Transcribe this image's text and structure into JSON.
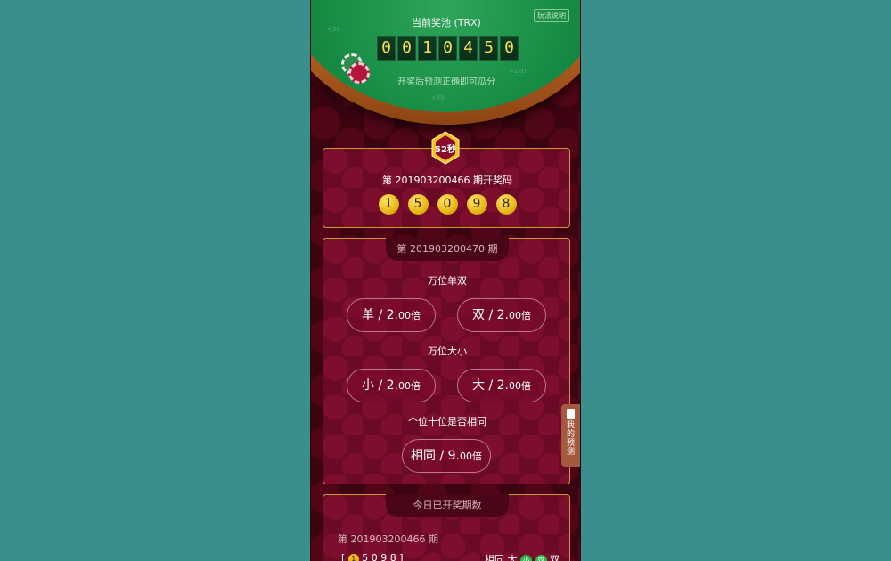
{
  "jackpot": {
    "title": "当前奖池 (TRX)",
    "rules_label": "玩法说明",
    "digits": [
      "0",
      "0",
      "1",
      "0",
      "4",
      "5",
      "0"
    ],
    "note": "开奖后预测正确即可瓜分",
    "faint_values": [
      "+50",
      "+220",
      "+50"
    ]
  },
  "timer": {
    "label": "52秒"
  },
  "last_result": {
    "title": "第 201903200466 期开奖码",
    "numbers": [
      "1",
      "5",
      "0",
      "9",
      "8"
    ]
  },
  "current_round": {
    "tab": "第 201903200470 期",
    "sections": [
      {
        "label": "万位单双",
        "options": [
          {
            "name": "单 / 2.",
            "odds": "00倍"
          },
          {
            "name": "双 / 2.",
            "odds": "00倍"
          }
        ]
      },
      {
        "label": "万位大小",
        "options": [
          {
            "name": "小 / 2.",
            "odds": "00倍"
          },
          {
            "name": "大 / 2.",
            "odds": "00倍"
          }
        ]
      },
      {
        "label": "个位十位是否相同",
        "options": [
          {
            "name": "相同 / 9.",
            "odds": "00倍"
          }
        ]
      }
    ]
  },
  "history": {
    "tab": "今日已开奖期数",
    "item": "第 201903200466 期",
    "row_left_open": "[",
    "row_left_first": "1",
    "row_left_rest": "5 0 9 8 ]",
    "row_right_same": "相同",
    "row_right_big": "大",
    "row_right_small_ball": "小",
    "row_right_double_ball": "双",
    "row_right_double": "双"
  },
  "side_tab": {
    "label": "我的预测"
  }
}
